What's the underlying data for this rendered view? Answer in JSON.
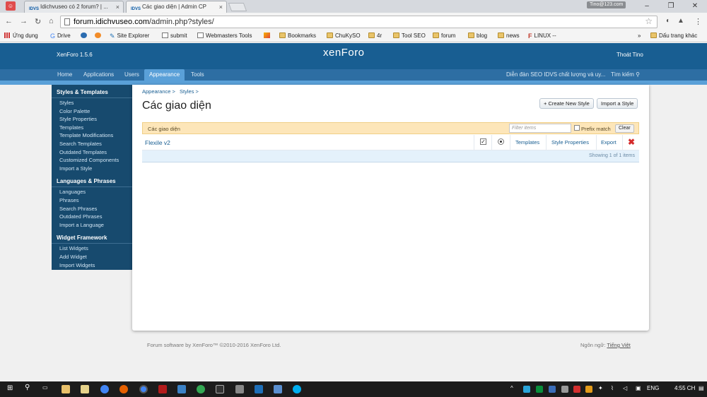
{
  "browser": {
    "tabs": [
      {
        "favicon": "IDVS",
        "title": "Idichvuseo có 2 forum? | ..."
      },
      {
        "favicon": "IDVS",
        "title": "Các giao diện | Admin CP"
      }
    ],
    "user_chip": "Tino@123.com",
    "url_host": "forum.idichvuseo.com",
    "url_path": "/admin.php?styles/",
    "bookmarks": [
      "Ứng dụng",
      "Drive",
      "Site Explorer",
      "submit",
      "Webmasters Tools",
      "Bookmarks",
      "ChuKySO",
      "4r",
      "Tool SEO",
      "forum",
      "blog",
      "news",
      "LINUX --"
    ],
    "bookmarks_overflow": "»",
    "other_bookmarks": "Dấu trang khác"
  },
  "xf": {
    "version": "XenForo 1.5.6",
    "logo": "xenForo",
    "logout": "Thoát Tino",
    "tabs": [
      "Home",
      "Applications",
      "Users",
      "Appearance",
      "Tools"
    ],
    "active_tab": "Appearance",
    "site_link": "Diễn đàn SEO IDVS chất lượng và uy...",
    "search_link": "Tìm kiếm"
  },
  "sidebar": [
    {
      "heading": "Styles & Templates",
      "links": [
        "Styles",
        "Color Palette",
        "Style Properties",
        "Templates",
        "Template Modifications",
        "Search Templates",
        "Outdated Templates",
        "Customized Components",
        "Import a Style"
      ]
    },
    {
      "heading": "Languages & Phrases",
      "links": [
        "Languages",
        "Phrases",
        "Search Phrases",
        "Outdated Phrases",
        "Import a Language"
      ]
    },
    {
      "heading": "Widget Framework",
      "links": [
        "List Widgets",
        "Add Widget",
        "Import Widgets"
      ]
    }
  ],
  "content": {
    "breadcrumb": [
      "Appearance >",
      "Styles >"
    ],
    "title": "Các giao diện",
    "create_button": "+ Create New Style",
    "import_button": "Import a Style",
    "filter_label": "Các giao diện",
    "filter_placeholder": "Filter items",
    "prefix_match": "Prefix match",
    "clear": "Clear",
    "row": {
      "name": "Flexile v2",
      "templates": "Templates",
      "style_properties": "Style Properties",
      "export": "Export"
    },
    "summary": "Showing 1 of 1 items"
  },
  "footer": {
    "copyright": "Forum software by XenForo™ ©2010-2016 XenForo Ltd.",
    "language_label": "Ngôn ngữ:",
    "language_value": "Tiếng Việt"
  },
  "taskbar": {
    "lang": "ENG",
    "time": "4:55 CH"
  }
}
